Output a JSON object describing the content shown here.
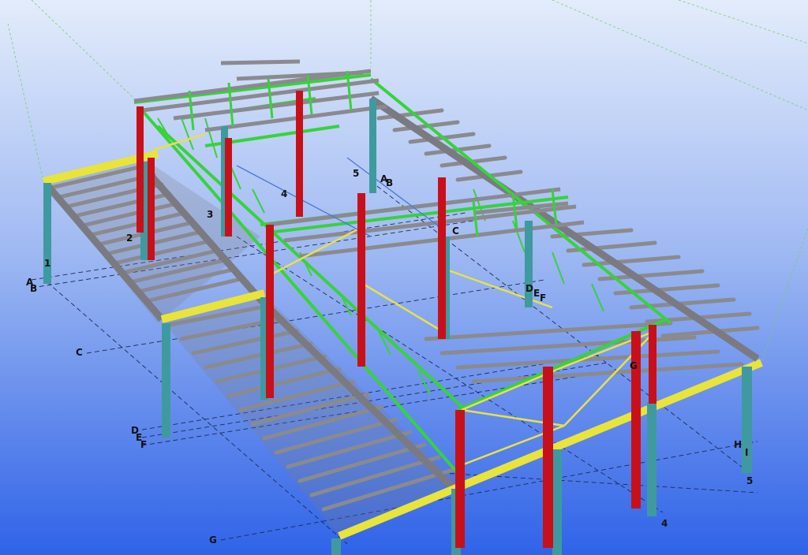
{
  "grid_labels": {
    "a_left": "A",
    "b_left": "B",
    "c_left": "C",
    "d_left": "D",
    "e_left": "E",
    "f_left": "F",
    "g_bottom": "G",
    "n1": "1",
    "n2": "2",
    "n3": "3",
    "n4": "4",
    "n5_top": "5",
    "a_mid": "A",
    "b_mid": "B",
    "c_mid": "C",
    "d_mid": "D",
    "e_mid": "E",
    "f_mid": "F",
    "g_mid": "G",
    "h_right": "H",
    "i_right": "I",
    "n5_right": "5",
    "n4_bottom": "4"
  },
  "colors": {
    "background_top": "#e3ecfb",
    "background_bottom": "#2f63e8",
    "column_teal": "#3f9aa0",
    "column_red": "#c8101a",
    "truss_green": "#38d23a",
    "beam_yellow": "#e9e43a",
    "steel_grey": "#8a8a8f",
    "bracing_yellow": "#e6e24a"
  }
}
